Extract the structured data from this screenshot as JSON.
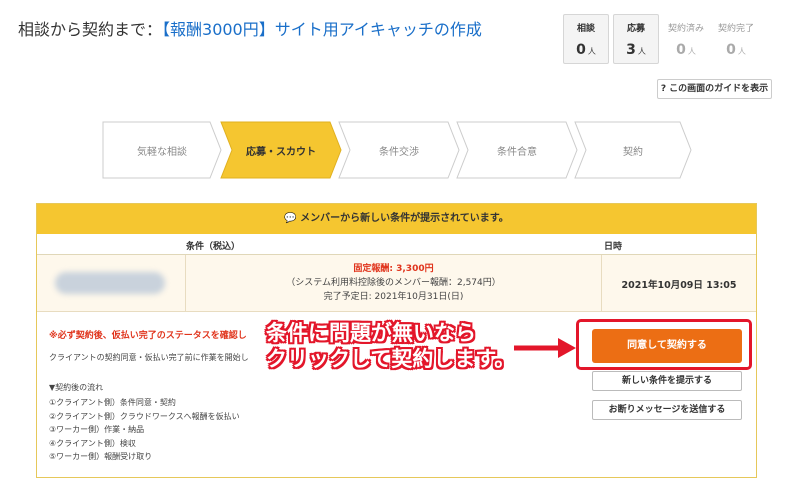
{
  "header": {
    "title_prefix": "相談から契約まで：",
    "title_link": "【報酬3000円】サイト用アイキャッチの作成"
  },
  "stats": [
    {
      "label": "相談",
      "value": "0",
      "unit": "人"
    },
    {
      "label": "応募",
      "value": "3",
      "unit": "人"
    },
    {
      "label": "契約済み",
      "value": "0",
      "unit": "人"
    },
    {
      "label": "契約完了",
      "value": "0",
      "unit": "人"
    }
  ],
  "guide_button": "? この画面のガイドを表示",
  "steps": [
    {
      "label": "気軽な相談"
    },
    {
      "label": "応募・スカウト"
    },
    {
      "label": "条件交渉"
    },
    {
      "label": "条件合意"
    },
    {
      "label": "契約"
    }
  ],
  "panel": {
    "heading": "メンバーから新しい条件が提示されています。",
    "col_condition": "条件（税込）",
    "col_date": "日時",
    "price": "固定報酬: 3,300円",
    "fee_note": "（システム利用料控除後のメンバー報酬：2,574円）",
    "due": "完了予定日: 2021年10月31日(日)",
    "date": "2021年10月09日 13:05",
    "warning": "※必ず契約後、仮払い完了のステータスを確認し",
    "note": "クライアントの契約同意・仮払い完了前に作業を開始し",
    "flow_title": "▼契約後の流れ",
    "flow": [
      "①クライアント側）条件同意・契約",
      "②クライアント側）クラウドワークスへ報酬を仮払い",
      "③ワーカー側）作業・納品",
      "④クライアント側）検収",
      "⑤ワーカー側）報酬受け取り"
    ]
  },
  "buttons": {
    "agree": "同意して契約する",
    "propose": "新しい条件を提示する",
    "decline": "お断りメッセージを送信する"
  },
  "annotation": {
    "line1": "条件に問題が無いなら",
    "line2": "クリックして契約します。"
  },
  "colors": {
    "accent_yellow": "#f5c630",
    "agree_orange": "#ec6e14",
    "highlight_red": "#e3162a",
    "link_blue": "#1a6fc9"
  }
}
